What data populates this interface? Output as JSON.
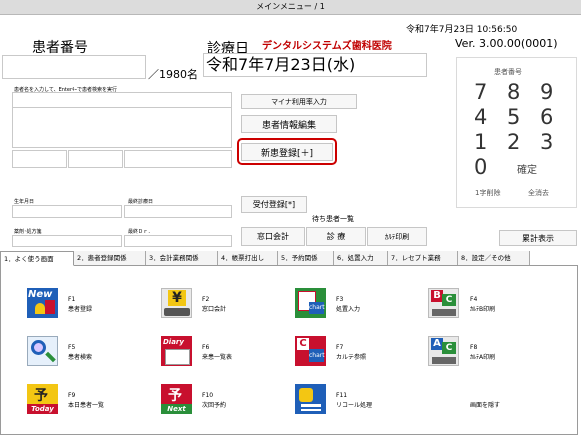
{
  "window": {
    "title": "メインメニュー / 1"
  },
  "header": {
    "date_time_line": "令和7年7月23日 10:56:50",
    "version": "Ver. 3.00.00(0001)",
    "patient_number_label": "患者番号",
    "patient_count": "／1980名",
    "visit_date_label": "診療日",
    "clinic_name": "デンタルシステムズ歯科医院",
    "visit_date_value": "令和7年7月23日(水)"
  },
  "search": {
    "hint": "患者名を入力して、Enterｷｰで患者検索を実行"
  },
  "info_labels": {
    "birthdate": "生年月日",
    "last_visit": "最終診療日",
    "drug_allergy": "薬剤･処方箋",
    "last_doctor": "最終Ｄｒ．"
  },
  "buttons": {
    "my_number": "マイナ利用率入力",
    "edit_patient": "患者情報編集",
    "new_patient": "新患登録[＋]",
    "reception": "受付登録[*]",
    "clinic_accounting": "窓口会計",
    "treatment": "診 療",
    "chart_print": "ｶﾙﾃ印刷",
    "receipt_display": "累計表示",
    "waiting_list_label": "待ち患者一覧"
  },
  "keypad": {
    "title": "患者番号",
    "keys": [
      "7",
      "8",
      "9",
      "4",
      "5",
      "6",
      "1",
      "2",
      "3",
      "0"
    ],
    "confirm": "確定",
    "delete_one": "1字削除",
    "clear_all": "全消去"
  },
  "tabs": [
    "1．よく使う画面",
    "2．患者登録関係",
    "3．会計業務関係",
    "4．帳票打出し",
    "5．予約関係",
    "6．処置入力",
    "7．レセプト業務",
    "8．設定／その他"
  ],
  "functions": [
    {
      "key": "F1",
      "label": "患者登録",
      "icon": "new-patient-icon"
    },
    {
      "key": "F2",
      "label": "窓口会計",
      "icon": "yen-register-icon"
    },
    {
      "key": "F3",
      "label": "処置入力",
      "icon": "chart-edit-icon"
    },
    {
      "key": "F4",
      "label": "ｶﾙﾃB印刷",
      "icon": "chart-b-print-icon"
    },
    {
      "key": "F5",
      "label": "患者検索",
      "icon": "magnifier-icon"
    },
    {
      "key": "F6",
      "label": "来患一覧表",
      "icon": "diary-icon"
    },
    {
      "key": "F7",
      "label": "カルテ参照",
      "icon": "chart-reference-icon"
    },
    {
      "key": "F8",
      "label": "ｶﾙﾃA印刷",
      "icon": "chart-a-print-icon"
    },
    {
      "key": "F9",
      "label": "本日患者一覧",
      "icon": "today-icon"
    },
    {
      "key": "F10",
      "label": "次回予約",
      "icon": "next-appointment-icon"
    },
    {
      "key": "F11",
      "label": "リコール処理",
      "icon": "recall-icon"
    },
    {
      "key": "",
      "label": "画面を隠す",
      "icon": ""
    }
  ],
  "colors": {
    "clinic_name": "#c00000",
    "highlight_border": "#cc0000",
    "icon_blue": "#1f5fb8",
    "icon_red": "#c8102e",
    "icon_green": "#2a8f3a",
    "icon_yellow": "#f3c613"
  }
}
